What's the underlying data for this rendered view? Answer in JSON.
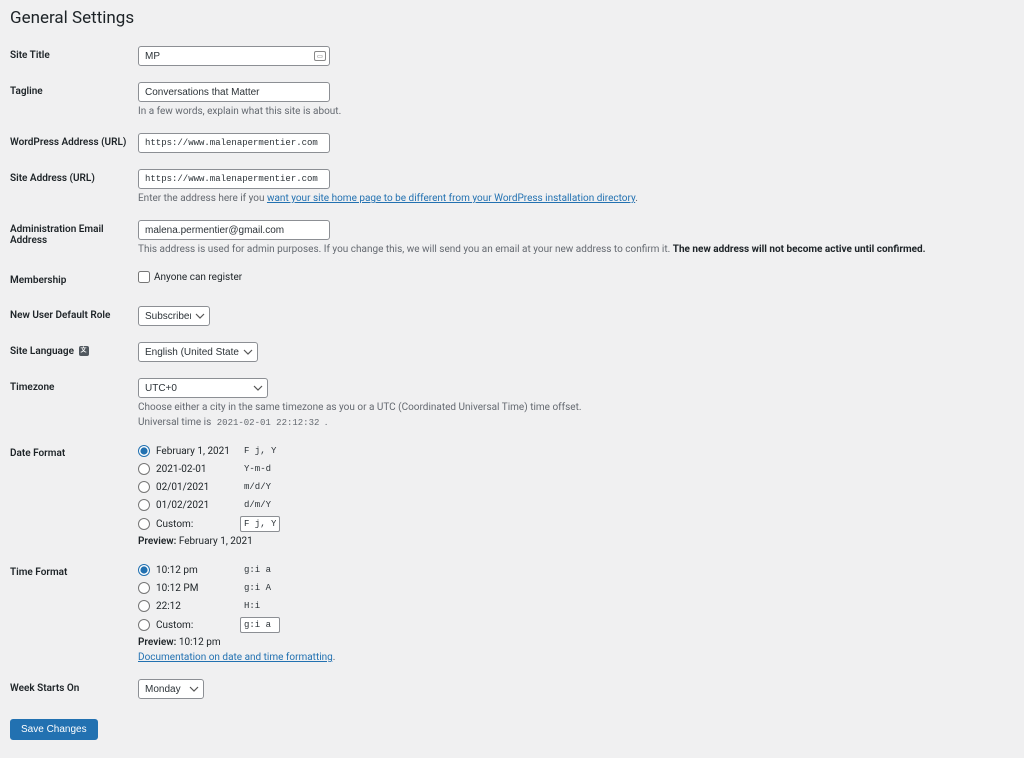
{
  "page_title": "General Settings",
  "labels": {
    "site_title": "Site Title",
    "tagline": "Tagline",
    "wp_url": "WordPress Address (URL)",
    "site_url": "Site Address (URL)",
    "admin_email": "Administration Email Address",
    "membership": "Membership",
    "new_user_role": "New User Default Role",
    "site_language": "Site Language",
    "timezone": "Timezone",
    "date_format": "Date Format",
    "time_format": "Time Format",
    "week_starts": "Week Starts On"
  },
  "values": {
    "site_title": "MP",
    "tagline": "Conversations that Matter",
    "wp_url": "https://www.malenapermentier.com",
    "site_url": "https://www.malenapermentier.com",
    "admin_email": "malena.permentier@gmail.com",
    "new_user_role": "Subscriber",
    "site_language": "English (United States)",
    "timezone": "UTC+0",
    "week_starts": "Monday"
  },
  "helps": {
    "tagline": "In a few words, explain what this site is about.",
    "site_url_pre": "Enter the address here if you ",
    "site_url_link": "want your site home page to be different from your WordPress installation directory",
    "admin_email_pre": "This address is used for admin purposes. If you change this, we will send you an email at your new address to confirm it. ",
    "admin_email_bold": "The new address will not become active until confirmed.",
    "timezone": "Choose either a city in the same timezone as you or a UTC (Coordinated Universal Time) time offset.",
    "uni_time_pre": "Universal time is ",
    "uni_time_code": "2021-02-01 22:12:32",
    "doc_link": "Documentation on date and time formatting"
  },
  "membership_option": "Anyone can register",
  "date_formats": [
    {
      "label": "February 1, 2021",
      "code": "F j, Y",
      "checked": true
    },
    {
      "label": "2021-02-01",
      "code": "Y-m-d",
      "checked": false
    },
    {
      "label": "02/01/2021",
      "code": "m/d/Y",
      "checked": false
    },
    {
      "label": "01/02/2021",
      "code": "d/m/Y",
      "checked": false
    }
  ],
  "date_custom_label": "Custom:",
  "date_custom_value": "F j, Y",
  "date_preview_label": "Preview:",
  "date_preview_value": "February 1, 2021",
  "time_formats": [
    {
      "label": "10:12 pm",
      "code": "g:i a",
      "checked": true
    },
    {
      "label": "10:12 PM",
      "code": "g:i A",
      "checked": false
    },
    {
      "label": "22:12",
      "code": "H:i",
      "checked": false
    }
  ],
  "time_custom_label": "Custom:",
  "time_custom_value": "g:i a",
  "time_preview_label": "Preview:",
  "time_preview_value": "10:12 pm",
  "submit_label": "Save Changes"
}
